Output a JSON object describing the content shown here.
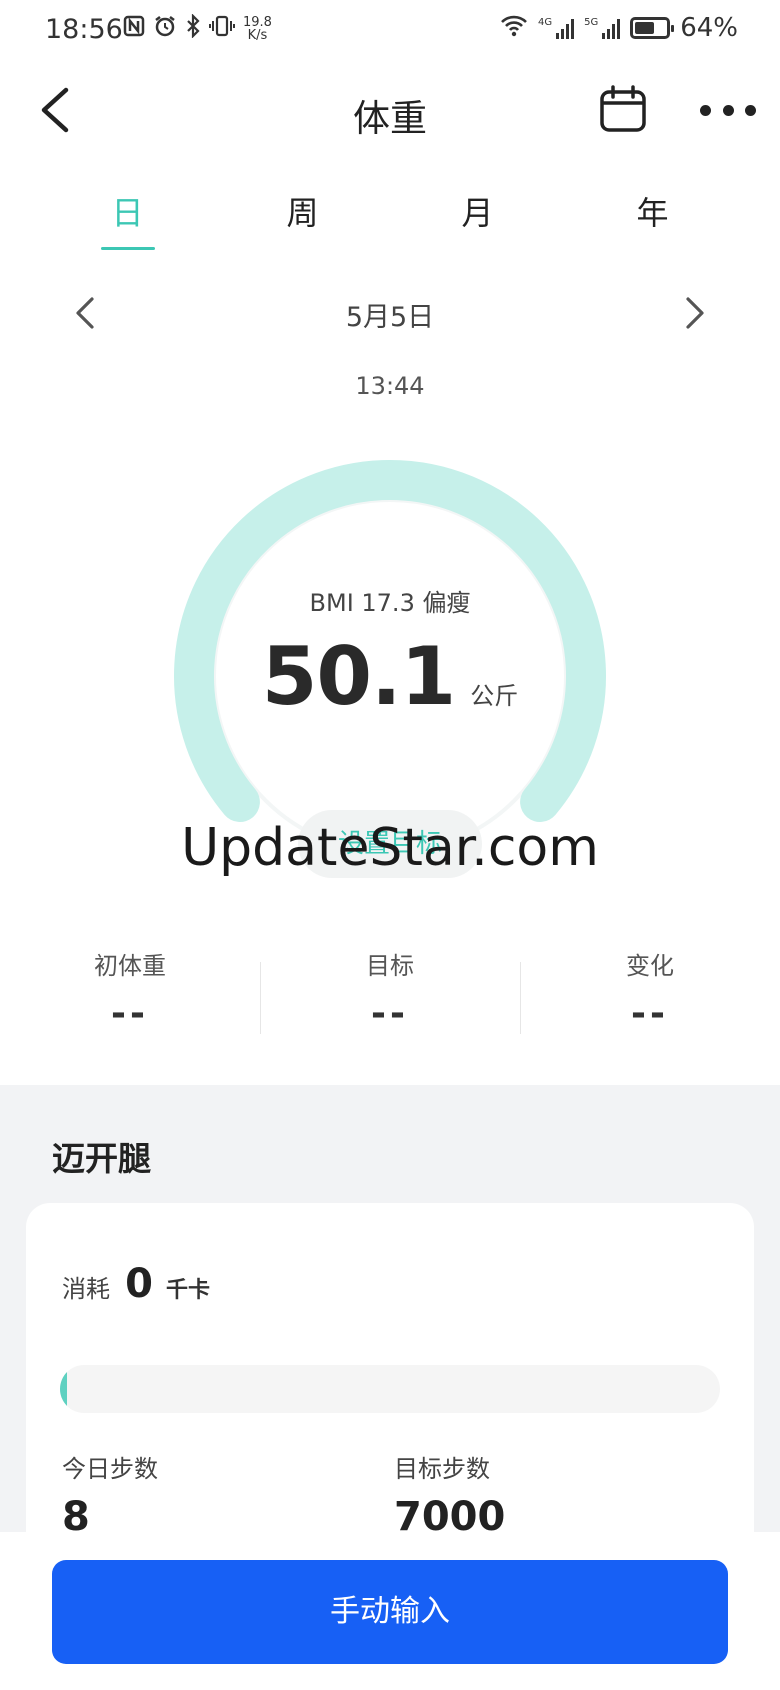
{
  "status_bar": {
    "time": "18:56",
    "speed_value": "19.8",
    "speed_unit": "K/s",
    "net1": "4G",
    "net2": "5G",
    "battery_pct": "64%",
    "battery_level": 0.64
  },
  "header": {
    "title": "体重",
    "back_icon": "chevron-left-icon",
    "calendar_icon": "calendar-icon",
    "more_icon": "more-dots-icon"
  },
  "tabs": [
    {
      "label": "日",
      "active": true
    },
    {
      "label": "周",
      "active": false
    },
    {
      "label": "月",
      "active": false
    },
    {
      "label": "年",
      "active": false
    }
  ],
  "date_nav": {
    "date": "5月5日",
    "time": "13:44"
  },
  "gauge": {
    "bmi_text": "BMI 17.3 偏瘦",
    "weight": "50.1",
    "unit": "公斤",
    "set_goal": "设置目标",
    "accent_color": "#3cc7b4",
    "track_color": "#c6f0ea"
  },
  "watermark": "UpdateStar.com",
  "stats": [
    {
      "label": "初体重",
      "value": "--"
    },
    {
      "label": "目标",
      "value": "--"
    },
    {
      "label": "变化",
      "value": "--"
    }
  ],
  "section": {
    "title": "迈开腿",
    "burn_label": "消耗",
    "burn_value": "0",
    "burn_unit": "千卡",
    "progress": 0.01,
    "today_steps_label": "今日步数",
    "today_steps": "8",
    "target_steps_label": "目标步数",
    "target_steps": "7000"
  },
  "manual_input": {
    "label": "手动输入",
    "color": "#1760f5"
  }
}
